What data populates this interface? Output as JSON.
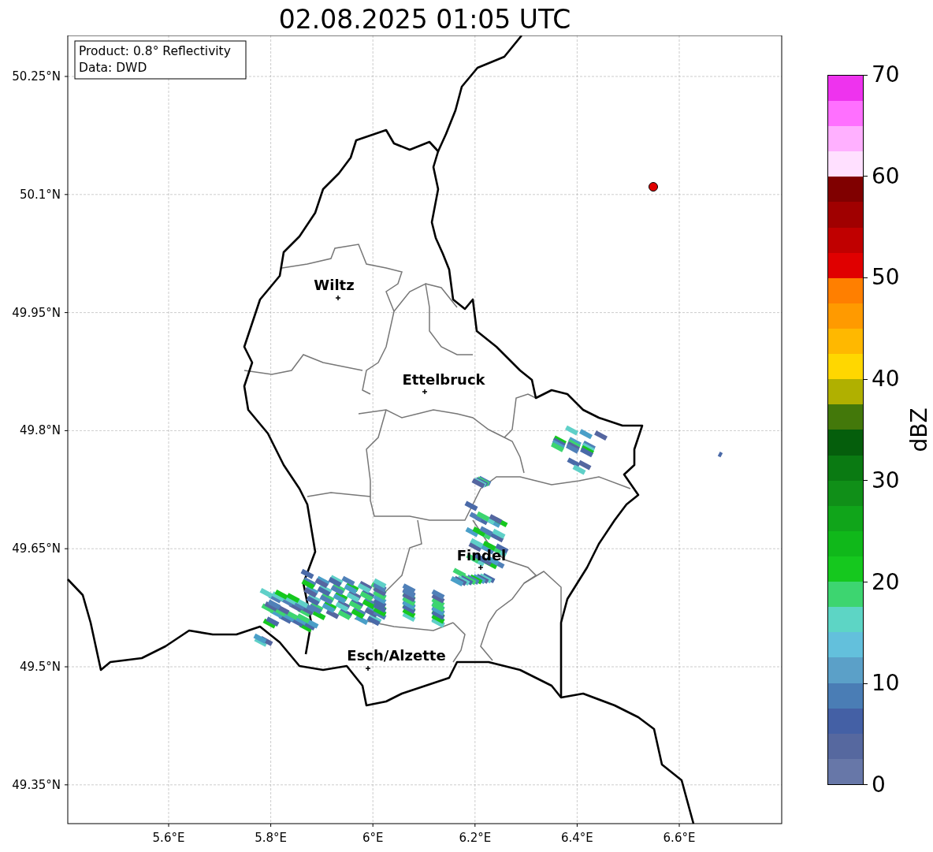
{
  "title": "02.08.2025 01:05 UTC",
  "map": {
    "info_box": [
      "Product: 0.8° Reflectivity",
      "Data: DWD"
    ],
    "lat_ticks": [
      "50.25°N",
      "50.1°N",
      "49.95°N",
      "49.8°N",
      "49.65°N",
      "49.5°N",
      "49.35°N"
    ],
    "lon_ticks": [
      "5.6°E",
      "5.8°E",
      "6°E",
      "6.2°E",
      "6.4°E",
      "6.6°E"
    ],
    "cities": [
      {
        "name": "Wiltz"
      },
      {
        "name": "Ettelbruck"
      },
      {
        "name": "Findel"
      },
      {
        "name": "Esch/Alzette"
      }
    ]
  },
  "colorbar": {
    "label": "dBZ",
    "ticks": [
      "70",
      "60",
      "50",
      "40",
      "30",
      "20",
      "10",
      "0"
    ],
    "bins": [
      {
        "color": "#6777a8"
      },
      {
        "color": "#56689f"
      },
      {
        "color": "#4460a5"
      },
      {
        "color": "#4a7db5"
      },
      {
        "color": "#5ba0c8"
      },
      {
        "color": "#63c0dc"
      },
      {
        "color": "#5dd5c5"
      },
      {
        "color": "#3dd570"
      },
      {
        "color": "#15c81e"
      },
      {
        "color": "#10b81a"
      },
      {
        "color": "#10a51a"
      },
      {
        "color": "#108f18"
      },
      {
        "color": "#0a7a12"
      },
      {
        "color": "#055e0c"
      },
      {
        "color": "#43780a"
      },
      {
        "color": "#b0b000"
      },
      {
        "color": "#ffd700"
      },
      {
        "color": "#ffb800"
      },
      {
        "color": "#ff9a00"
      },
      {
        "color": "#ff7f00"
      },
      {
        "color": "#e00000"
      },
      {
        "color": "#c00000"
      },
      {
        "color": "#a00000"
      },
      {
        "color": "#800000"
      },
      {
        "color": "#ffe0ff"
      },
      {
        "color": "#ffb0ff"
      },
      {
        "color": "#ff70ff"
      },
      {
        "color": "#ee33ee"
      }
    ]
  }
}
